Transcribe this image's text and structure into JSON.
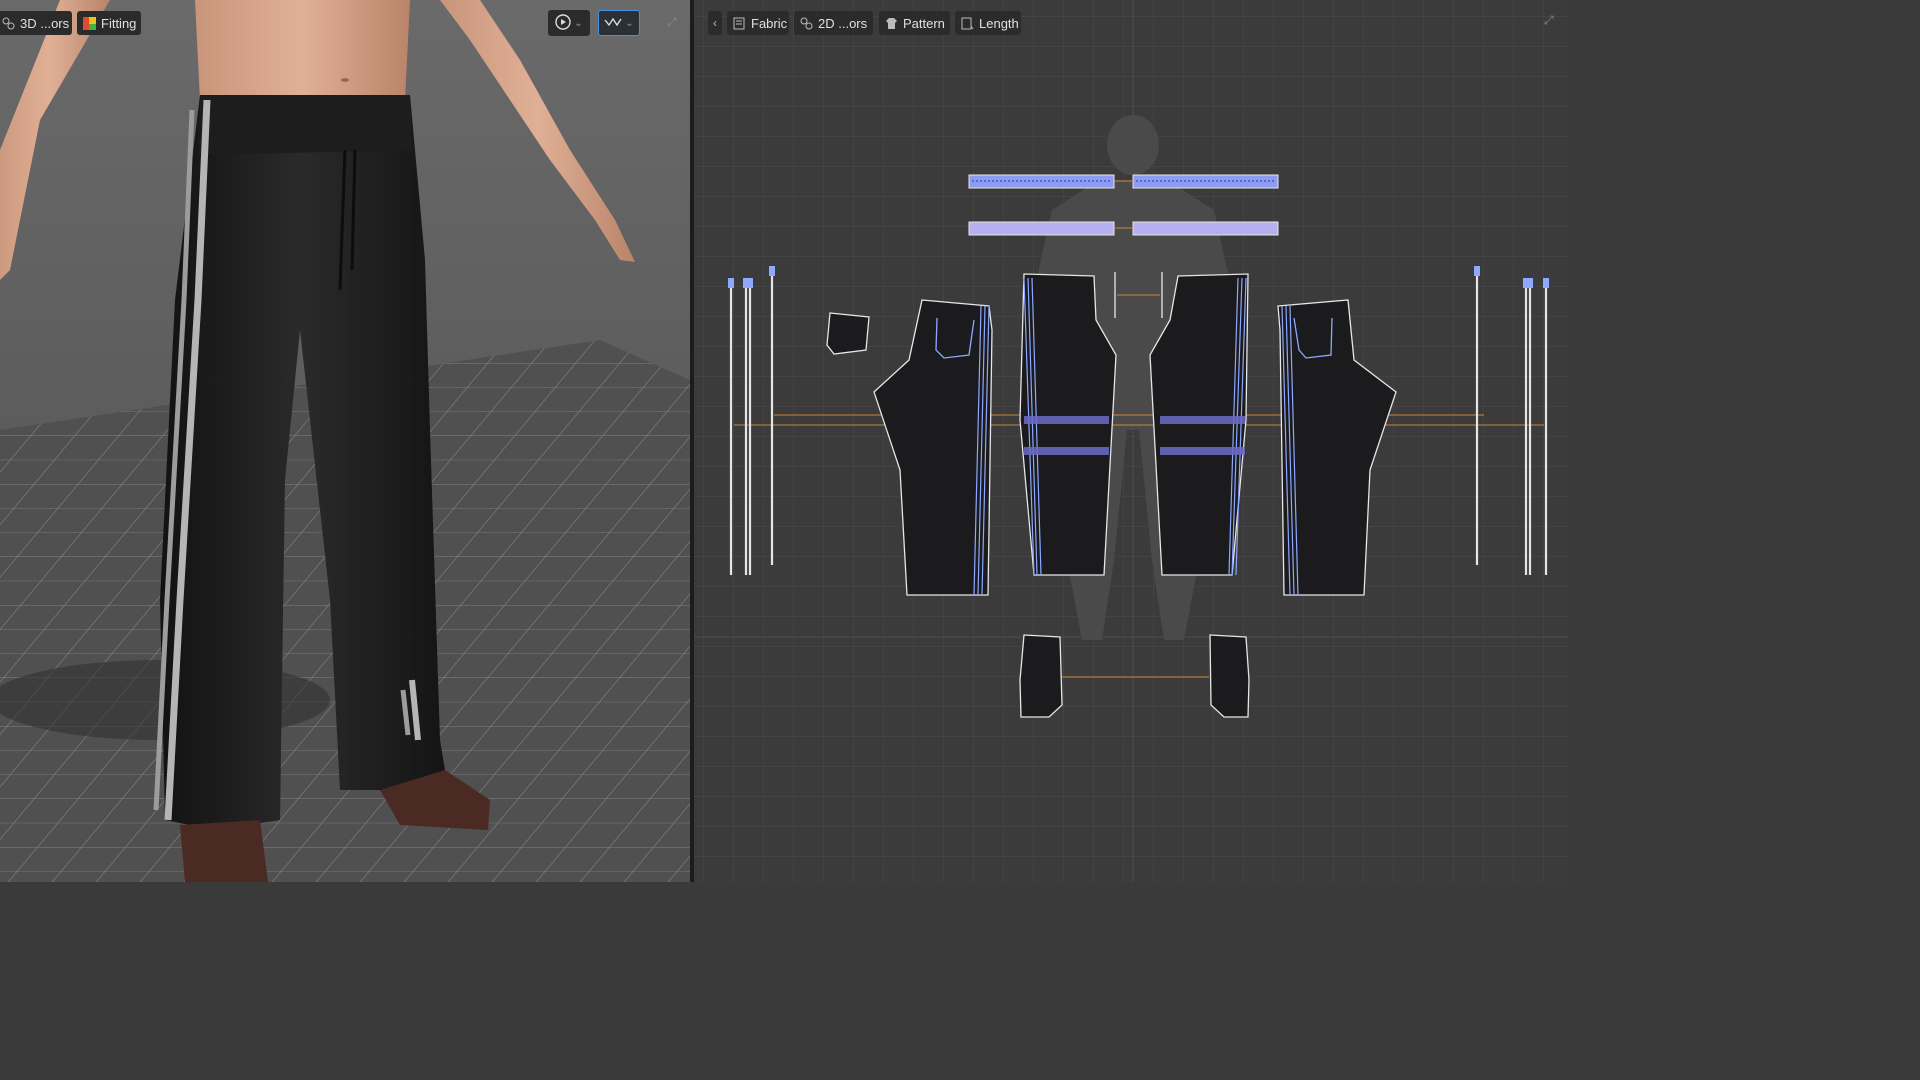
{
  "viewport3d": {
    "toolbar": {
      "colorway_label": "3D ...ors",
      "fitting_label": "Fitting",
      "play_icon": "play-icon",
      "display_mode_icon": "display-mode-icon",
      "expand_icon": "expand-icon"
    }
  },
  "viewport2d": {
    "toolbar": {
      "collapse_icon": "chevron-left-icon",
      "fabric_label": "Fabric",
      "colorway_label": "2D ...ors",
      "pattern_label": "Pattern",
      "length_label": "Length",
      "expand_icon": "expand-icon"
    }
  },
  "colors": {
    "accent": "#4a90e2",
    "pattern_piece": "#1b1b1d",
    "stitch_line": "#8fa8ff",
    "seam_line": "#c8863a",
    "outline": "#e6e6e6"
  }
}
